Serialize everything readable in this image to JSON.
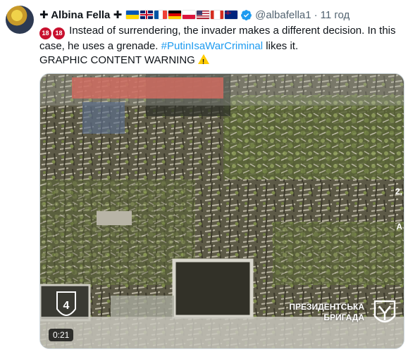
{
  "tweet": {
    "author_name": "Albina Fella",
    "name_prefix": "✚",
    "name_suffix": "✚",
    "handle": "@albafella1",
    "separator": "·",
    "time": "11 год",
    "verified_icon": "verified-check",
    "flags": [
      "ua",
      "gb",
      "fr",
      "de",
      "pl",
      "us",
      "ca",
      "au"
    ],
    "age_badge": "18",
    "text_main": "Instead of surrendering, the invader makes a different decision. In this case, he uses a grenade.",
    "hashtag": "#PutinIsaWarCriminal",
    "text_after_hashtag": "likes it.",
    "warning_text": "GRAPHIC CONTENT WARNING",
    "warning_icon": "warning-icon"
  },
  "video": {
    "duration": "0:21",
    "brand_line1": "ПРЕЗИДЕНТСЬКА",
    "brand_line2": "БРИГАДА",
    "side_labels": [
      "2,",
      "A"
    ]
  },
  "colors": {
    "accent": "#1d9bf0",
    "text": "#0f1419",
    "muted": "#536471"
  }
}
